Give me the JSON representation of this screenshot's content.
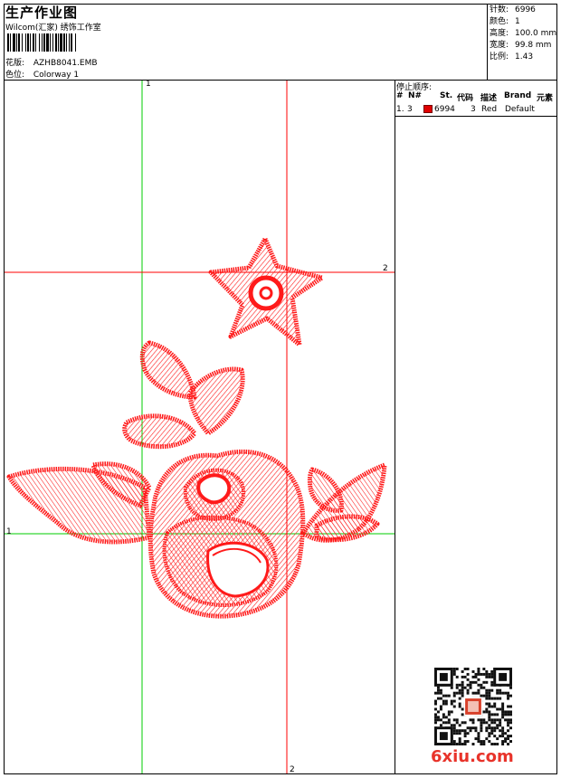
{
  "header": {
    "title": "生产作业图",
    "company": "Wilcom(汇家) 绣饰工作室",
    "design_label": "花版:",
    "design_value": "AZHB8041.EMB",
    "colorway_label": "色位:",
    "colorway_value": "Colorway 1"
  },
  "stats": {
    "stitches_label": "针数:",
    "stitches_value": "6996",
    "colors_label": "颜色:",
    "colors_value": "1",
    "height_label": "高度:",
    "height_value": "100.0 mm",
    "width_label": "宽度:",
    "width_value": "99.8 mm",
    "scale_label": "比例:",
    "scale_value": "1.43"
  },
  "stop_sequence": {
    "title": "停止顺序:",
    "columns": [
      "#",
      "N#",
      "St.",
      "代码",
      "描述",
      "Brand",
      "元素"
    ],
    "rows": [
      {
        "index": "1.",
        "needle": "3",
        "stitches": "6994",
        "code": "3",
        "description": "Red",
        "brand": "Default",
        "swatch_color": "#e00000"
      }
    ]
  },
  "guides": {
    "vertical_top": "1",
    "horizontal_right": "2",
    "horizontal_left": "1",
    "vertical_bottom": "2"
  },
  "colors": {
    "thread": "#ff1a1a",
    "guide_green": "#00cc00",
    "guide_red": "#ff0000"
  },
  "watermark": {
    "text": "6xiu.com"
  }
}
